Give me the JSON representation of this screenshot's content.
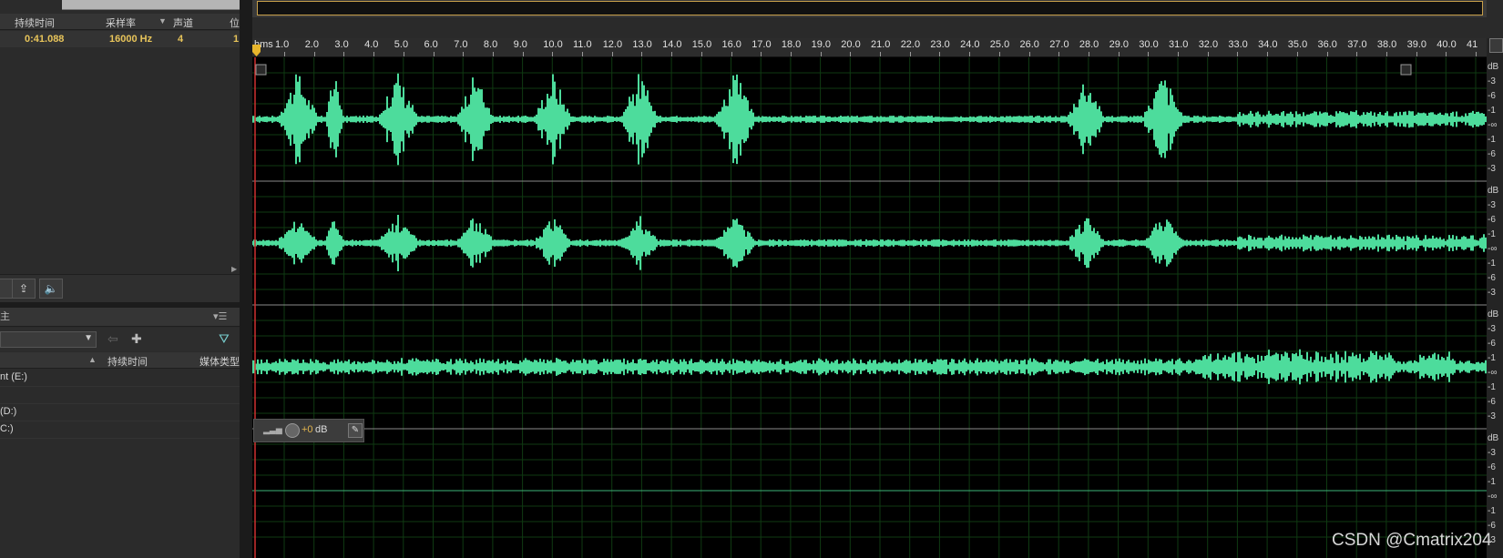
{
  "files_panel": {
    "columns": [
      "持续时间",
      "采样率",
      "声道",
      "位"
    ],
    "row": {
      "duration": "0:41.088",
      "sample_rate": "16000 Hz",
      "channels": "4",
      "bits": "1"
    }
  },
  "media_panel": {
    "tab_label": "主",
    "columns": [
      "持续时间",
      "媒体类型"
    ],
    "drives": [
      "nt (E:)",
      "(D:)",
      "C:)"
    ]
  },
  "timeline": {
    "unit": "hms",
    "ticks": [
      "1.0",
      "2.0",
      "3.0",
      "4.0",
      "5.0",
      "6.0",
      "7.0",
      "8.0",
      "9.0",
      "10.0",
      "11.0",
      "12.0",
      "13.0",
      "14.0",
      "15.0",
      "16.0",
      "17.0",
      "18.0",
      "19.0",
      "20.0",
      "21.0",
      "22.0",
      "23.0",
      "24.0",
      "25.0",
      "26.0",
      "27.0",
      "28.0",
      "29.0",
      "30.0",
      "31.0",
      "32.0",
      "33.0",
      "34.0",
      "35.0",
      "36.0",
      "37.0",
      "38.0",
      "39.0",
      "40.0",
      "41"
    ]
  },
  "channels": [
    {
      "index": 1,
      "scale": [
        "dB",
        "-3",
        "-6",
        "-1",
        "-∞",
        "-1",
        "-6",
        "-3"
      ]
    },
    {
      "index": 2,
      "scale": [
        "dB",
        "-3",
        "-6",
        "-1",
        "-∞",
        "-1",
        "-6",
        "-3"
      ]
    },
    {
      "index": 3,
      "scale": [
        "dB",
        "-3",
        "-6",
        "-1",
        "-∞",
        "-1",
        "-6",
        "-3"
      ]
    },
    {
      "index": 4,
      "scale": [
        "dB",
        "-3",
        "-6",
        "-1",
        "-∞",
        "-1",
        "-6",
        "-3"
      ]
    }
  ],
  "hud": {
    "value": "+0",
    "unit": "dB"
  },
  "colors": {
    "waveform": "#4ddc9c",
    "playhead": "#d03030",
    "grid": "#0f3a12",
    "separator": "#8a8a8a"
  },
  "watermark": "CSDN @Cmatrix204"
}
